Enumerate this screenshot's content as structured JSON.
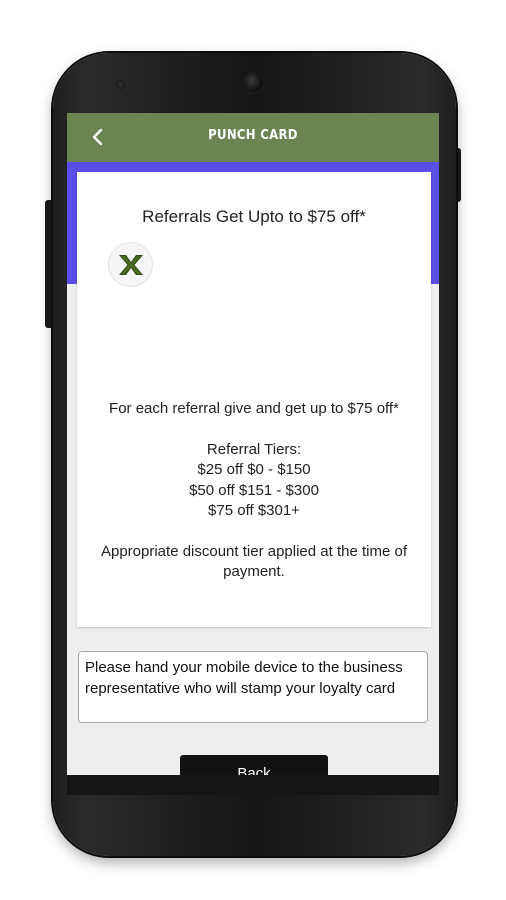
{
  "appbar": {
    "title": "PUNCH CARD",
    "back_icon": "chevron-left-icon",
    "background": "#6a8452"
  },
  "accent_color": "#5b4ee6",
  "card": {
    "title": "Referrals Get Upto to $75 off*",
    "logo_icon": "x-logo-icon",
    "intro": "For each referral give and get up to $75 off*",
    "tiers_heading": "Referral Tiers:",
    "tiers": [
      "$25 off $0 - $150",
      "$50 off $151 - $300",
      "$75 off $301+"
    ],
    "footer": "Appropriate discount tier applied at the time of payment."
  },
  "notice": {
    "text": "Please hand your mobile device to the business representative who will stamp your loyalty card"
  },
  "action_button": {
    "label": "Back"
  }
}
